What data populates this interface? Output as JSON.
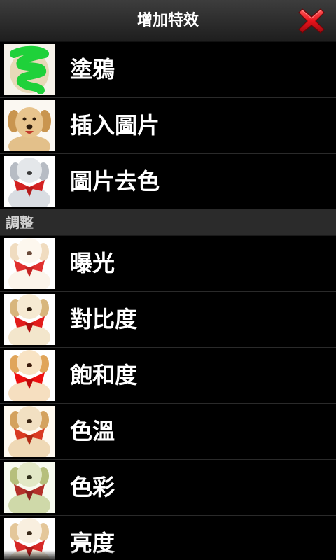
{
  "header": {
    "title": "增加特效",
    "close_icon": "close-icon"
  },
  "colors": {
    "close_red": "#e8131b",
    "scribble_green": "#1fd13a",
    "scarf_red": "#d42222"
  },
  "effects": [
    {
      "label": "塗鴉",
      "thumb": "scribble"
    },
    {
      "label": "插入圖片",
      "thumb": "dog"
    },
    {
      "label": "圖片去色",
      "thumb": "dog-gray"
    }
  ],
  "adjust_section": {
    "title": "調整",
    "items": [
      {
        "label": "曝光",
        "thumb": "dog-bright"
      },
      {
        "label": "對比度",
        "thumb": "dog-contrast"
      },
      {
        "label": "飽和度",
        "thumb": "dog-saturated"
      },
      {
        "label": "色溫",
        "thumb": "dog-warm"
      },
      {
        "label": "色彩",
        "thumb": "dog-tint"
      },
      {
        "label": "亮度",
        "thumb": "dog-light"
      }
    ]
  }
}
